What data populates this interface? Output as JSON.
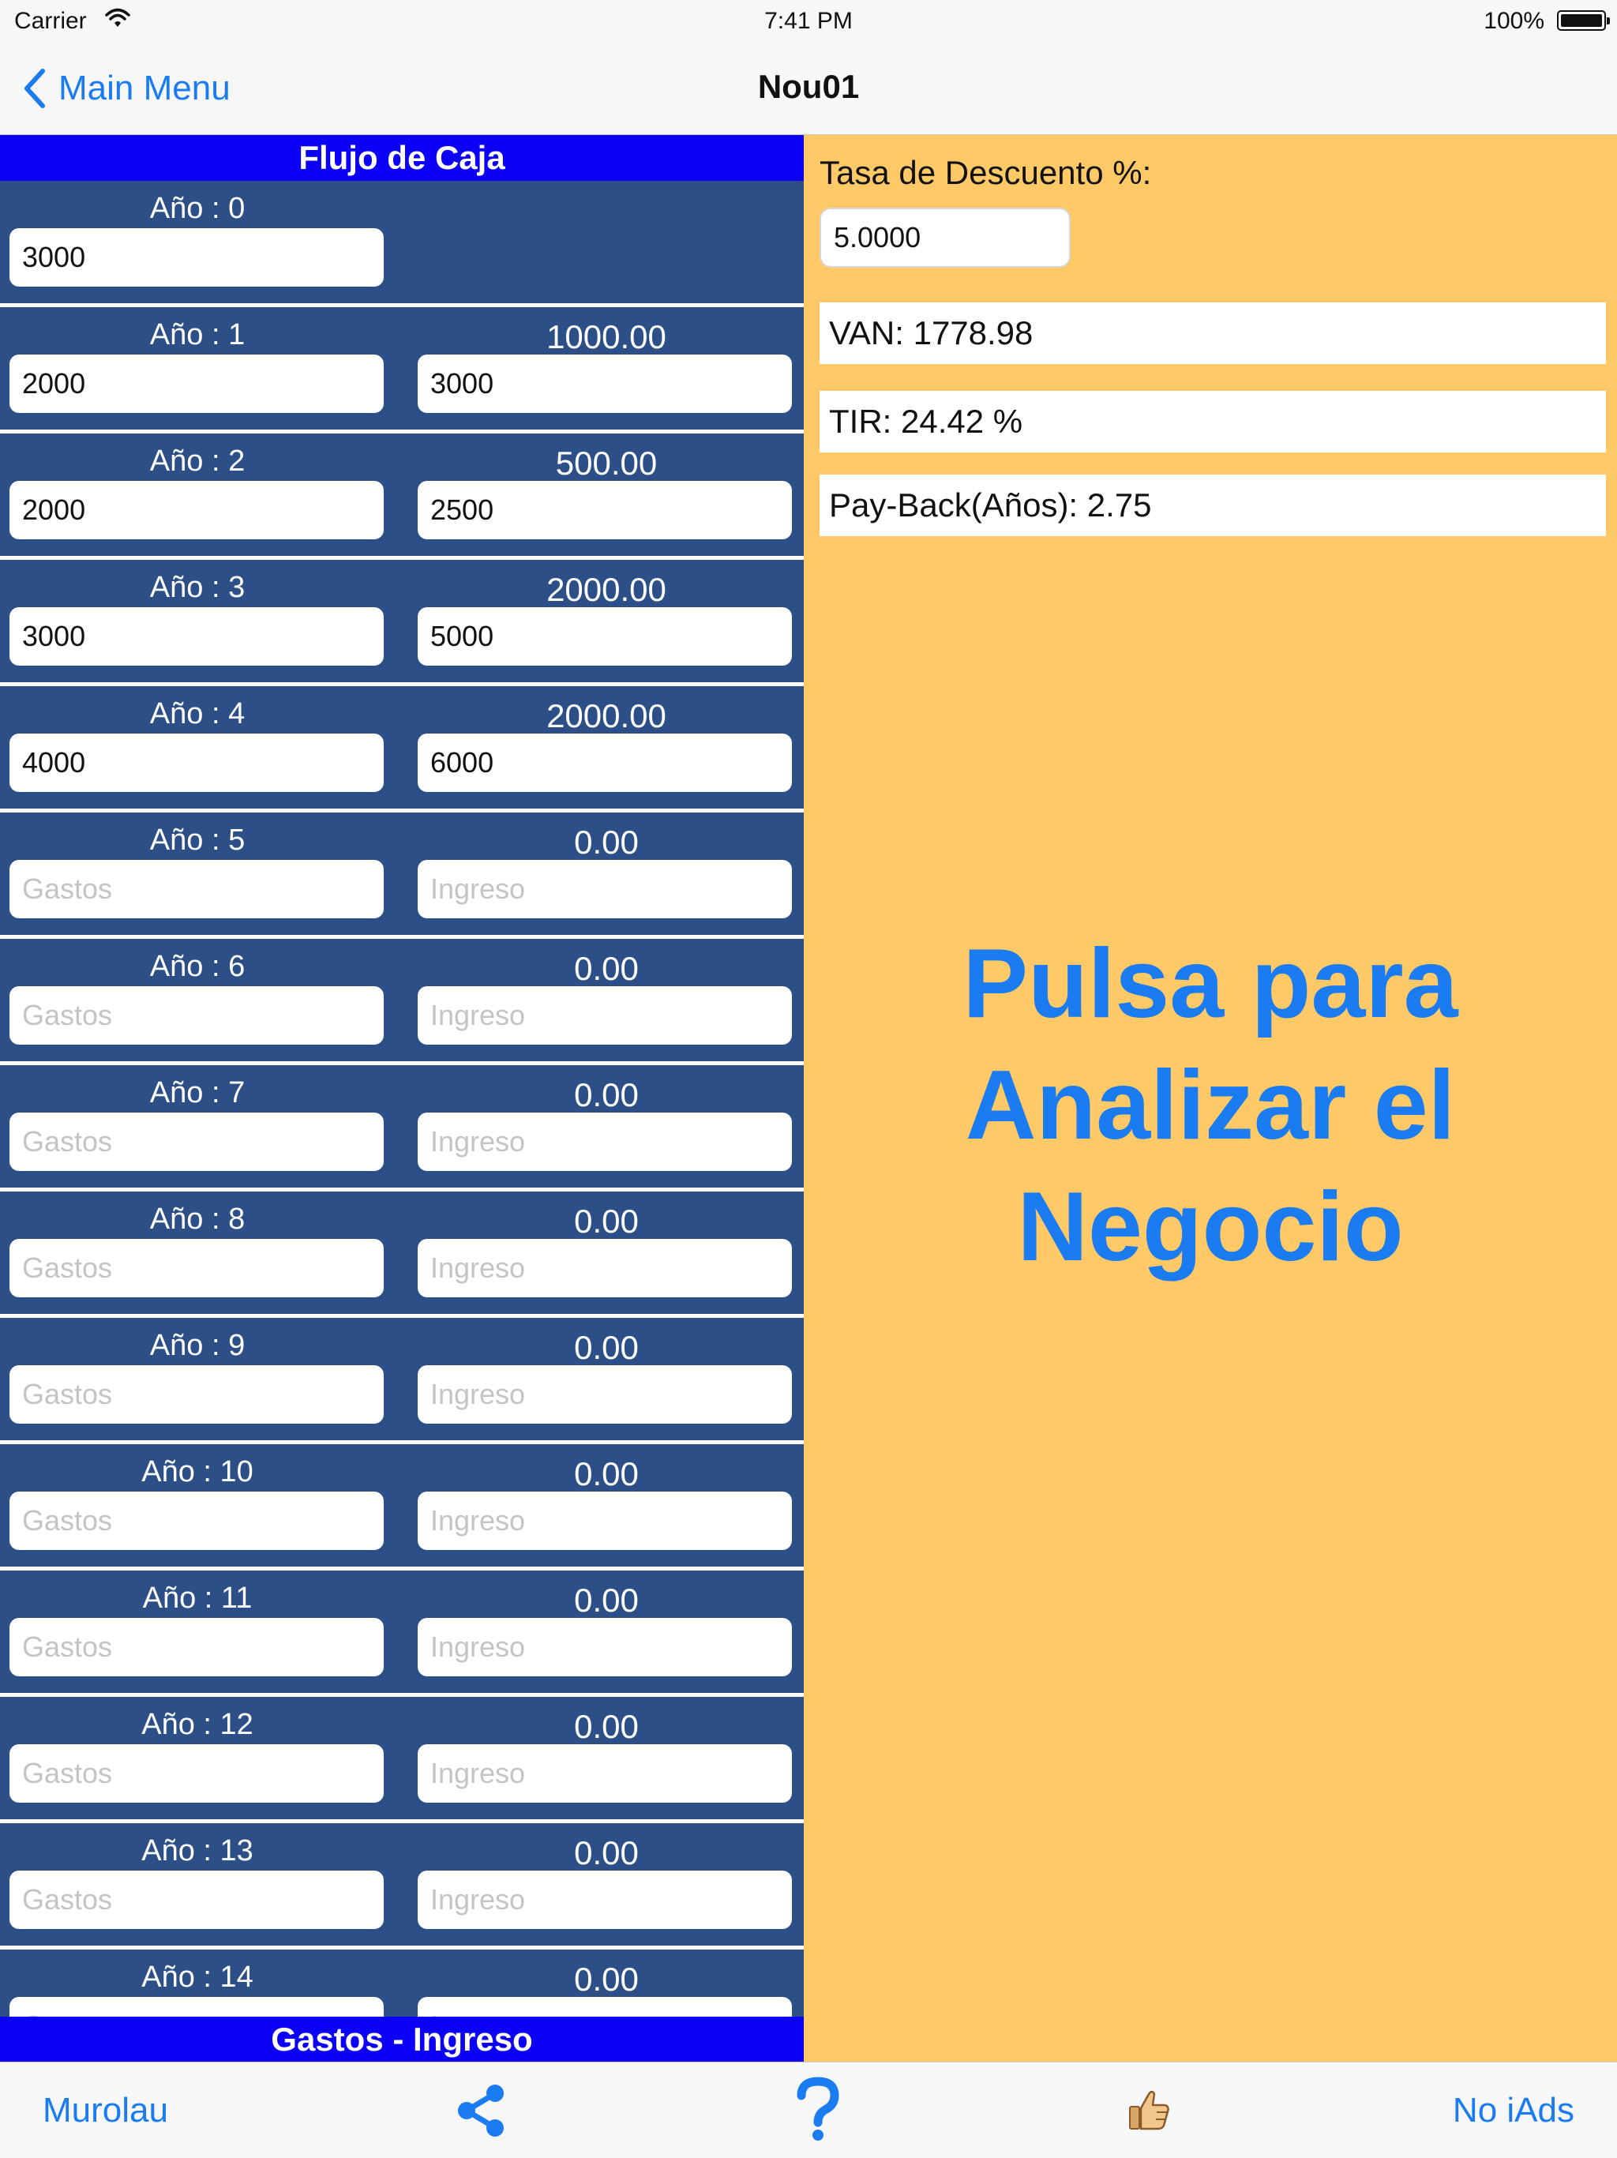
{
  "status_bar": {
    "carrier": "Carrier",
    "time": "7:41 PM",
    "battery": "100%"
  },
  "nav": {
    "back_label": "Main Menu",
    "title": "Nou01"
  },
  "cash_flow": {
    "header": "Flujo de Caja",
    "footer": "Gastos - Ingreso",
    "gastos_placeholder": "Gastos",
    "ingreso_placeholder": "Ingreso",
    "rows": [
      {
        "label": "Año : 0",
        "net": "",
        "gastos": "3000",
        "ingreso": ""
      },
      {
        "label": "Año : 1",
        "net": "1000.00",
        "gastos": "2000",
        "ingreso": "3000"
      },
      {
        "label": "Año : 2",
        "net": "500.00",
        "gastos": "2000",
        "ingreso": "2500"
      },
      {
        "label": "Año : 3",
        "net": "2000.00",
        "gastos": "3000",
        "ingreso": "5000"
      },
      {
        "label": "Año : 4",
        "net": "2000.00",
        "gastos": "4000",
        "ingreso": "6000"
      },
      {
        "label": "Año : 5",
        "net": "0.00",
        "gastos": "",
        "ingreso": ""
      },
      {
        "label": "Año : 6",
        "net": "0.00",
        "gastos": "",
        "ingreso": ""
      },
      {
        "label": "Año : 7",
        "net": "0.00",
        "gastos": "",
        "ingreso": ""
      },
      {
        "label": "Año : 8",
        "net": "0.00",
        "gastos": "",
        "ingreso": ""
      },
      {
        "label": "Año : 9",
        "net": "0.00",
        "gastos": "",
        "ingreso": ""
      },
      {
        "label": "Año : 10",
        "net": "0.00",
        "gastos": "",
        "ingreso": ""
      },
      {
        "label": "Año : 11",
        "net": "0.00",
        "gastos": "",
        "ingreso": ""
      },
      {
        "label": "Año : 12",
        "net": "0.00",
        "gastos": "",
        "ingreso": ""
      },
      {
        "label": "Año : 13",
        "net": "0.00",
        "gastos": "",
        "ingreso": ""
      },
      {
        "label": "Año : 14",
        "net": "0.00",
        "gastos": "",
        "ingreso": ""
      }
    ]
  },
  "analysis": {
    "rate_label": "Tasa de Descuento %:",
    "rate_value": "5.0000",
    "van": "VAN:  1778.98",
    "tir": "TIR:  24.42 %",
    "payback": "Pay-Back(Años):  2.75",
    "analyze_lines": [
      "Pulsa para",
      "Analizar el",
      "Negocio"
    ]
  },
  "tab_bar": {
    "left_label": "Murolau",
    "right_label": "No iAds",
    "icons": [
      "share-icon",
      "help-icon",
      "thumbs-up-icon"
    ]
  },
  "colors": {
    "accent_blue": "#1a7cf0",
    "header_blue": "#0b00f5",
    "row_navy": "#2d4f87",
    "panel_orange": "#fec966"
  }
}
